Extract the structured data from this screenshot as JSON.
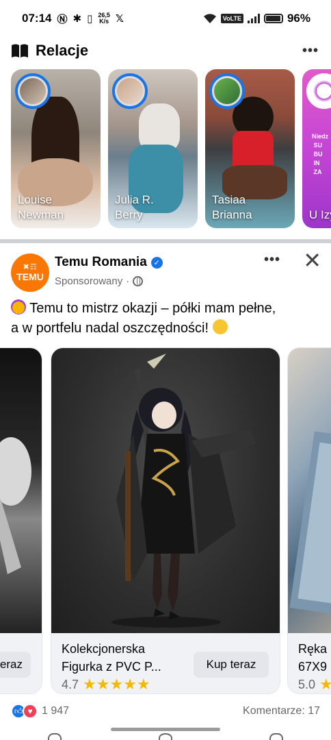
{
  "status_bar": {
    "time": "07:14",
    "speed_value": "26,5",
    "speed_unit": "K/s",
    "network": "VoLTE",
    "battery": "96%"
  },
  "stories": {
    "title": "Relacje",
    "items": [
      {
        "name_line1": "Louise",
        "name_line2": "Newman"
      },
      {
        "name_line1": "Julia R.",
        "name_line2": "Berry"
      },
      {
        "name_line1": "Tasiaa",
        "name_line2": "Brianna"
      },
      {
        "name_line1": "U Izy",
        "name_line2": "",
        "promo": "Niedz\nSU\nBU\nIN\nZA"
      }
    ]
  },
  "post": {
    "page_name": "Temu Romania",
    "avatar_line1": "✖₭☶",
    "avatar_line2": "TEMU",
    "sponsored": "Sponsorowany",
    "dot": "·",
    "text_line1": "Temu to mistrz okazji – półki mam pełne,",
    "text_line2": "a w portfelu nadal oszczędności!",
    "carousel": [
      {
        "title": "",
        "rating": "",
        "button": "eraz"
      },
      {
        "title_line1": "Kolekcjonerska",
        "title_line2": "Figurka z PVC P...",
        "rating": "4.7",
        "stars": "★★★★★",
        "button": "Kup teraz"
      },
      {
        "title_line1": "Ręka",
        "title_line2": "67X9",
        "rating": "5.0",
        "stars": "★"
      }
    ]
  },
  "reactions": {
    "count": "1 947",
    "comments": "Komentarze: 17"
  },
  "icons": {
    "stories": "book-icon",
    "more": "more-dots-icon",
    "close": "close-icon",
    "verified": "verified-badge-icon",
    "audience": "globe-icon",
    "like": "like-reaction-icon",
    "love": "love-reaction-icon"
  },
  "colors": {
    "accent": "#1b74e4",
    "temu": "#fb7701",
    "stars": "#f5b800",
    "love": "#f33e58"
  }
}
